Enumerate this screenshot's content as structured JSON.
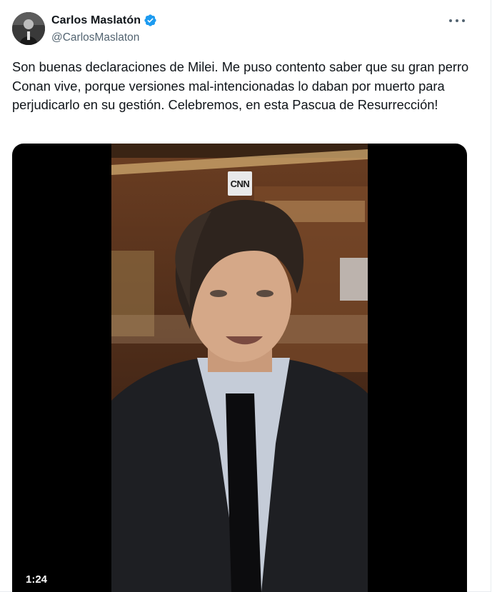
{
  "author": {
    "display_name": "Carlos Maslatón",
    "handle": "@CarlosMaslaton",
    "verified": true,
    "verified_color": "#1d9bf0"
  },
  "menu_icon": "more-horizontal-icon",
  "tweet": {
    "text": "Son buenas declaraciones de Milei. Me puso contento saber que su gran perro Conan vive, porque versiones mal-intencionadas lo daban por muerto para perjudicarlo en su gestión. Celebremos, en esta Pascua de Resurrección!"
  },
  "media": {
    "type": "video",
    "logo_text": "CNN",
    "duration": "1:24"
  }
}
